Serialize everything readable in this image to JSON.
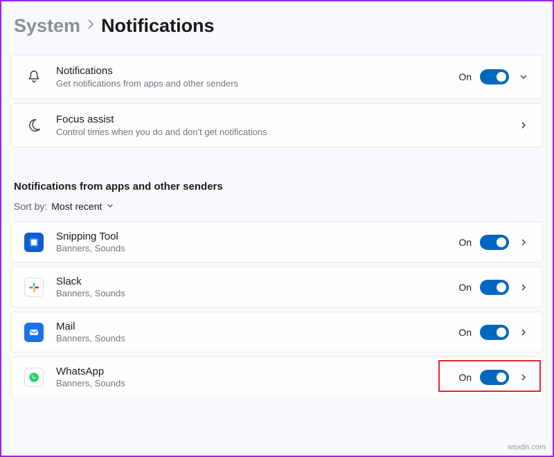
{
  "breadcrumb": {
    "parent": "System",
    "current": "Notifications"
  },
  "master": {
    "notifications": {
      "title": "Notifications",
      "desc": "Get notifications from apps and other senders",
      "status": "On"
    },
    "focus": {
      "title": "Focus assist",
      "desc": "Control times when you do and don't get notifications"
    }
  },
  "section_title": "Notifications from apps and other senders",
  "sort": {
    "label": "Sort by:",
    "value": "Most recent"
  },
  "apps": [
    {
      "name": "Snipping Tool",
      "detail": "Banners, Sounds",
      "status": "On",
      "icon": "snipping",
      "color": "#0b5ed7"
    },
    {
      "name": "Slack",
      "detail": "Banners, Sounds",
      "status": "On",
      "icon": "slack",
      "color": "#ffffff"
    },
    {
      "name": "Mail",
      "detail": "Banners, Sounds",
      "status": "On",
      "icon": "mail",
      "color": "#1a73e8"
    },
    {
      "name": "WhatsApp",
      "detail": "Banners, Sounds",
      "status": "On",
      "icon": "whatsapp",
      "color": "#25d366"
    }
  ],
  "watermark": "wsxdn.com"
}
